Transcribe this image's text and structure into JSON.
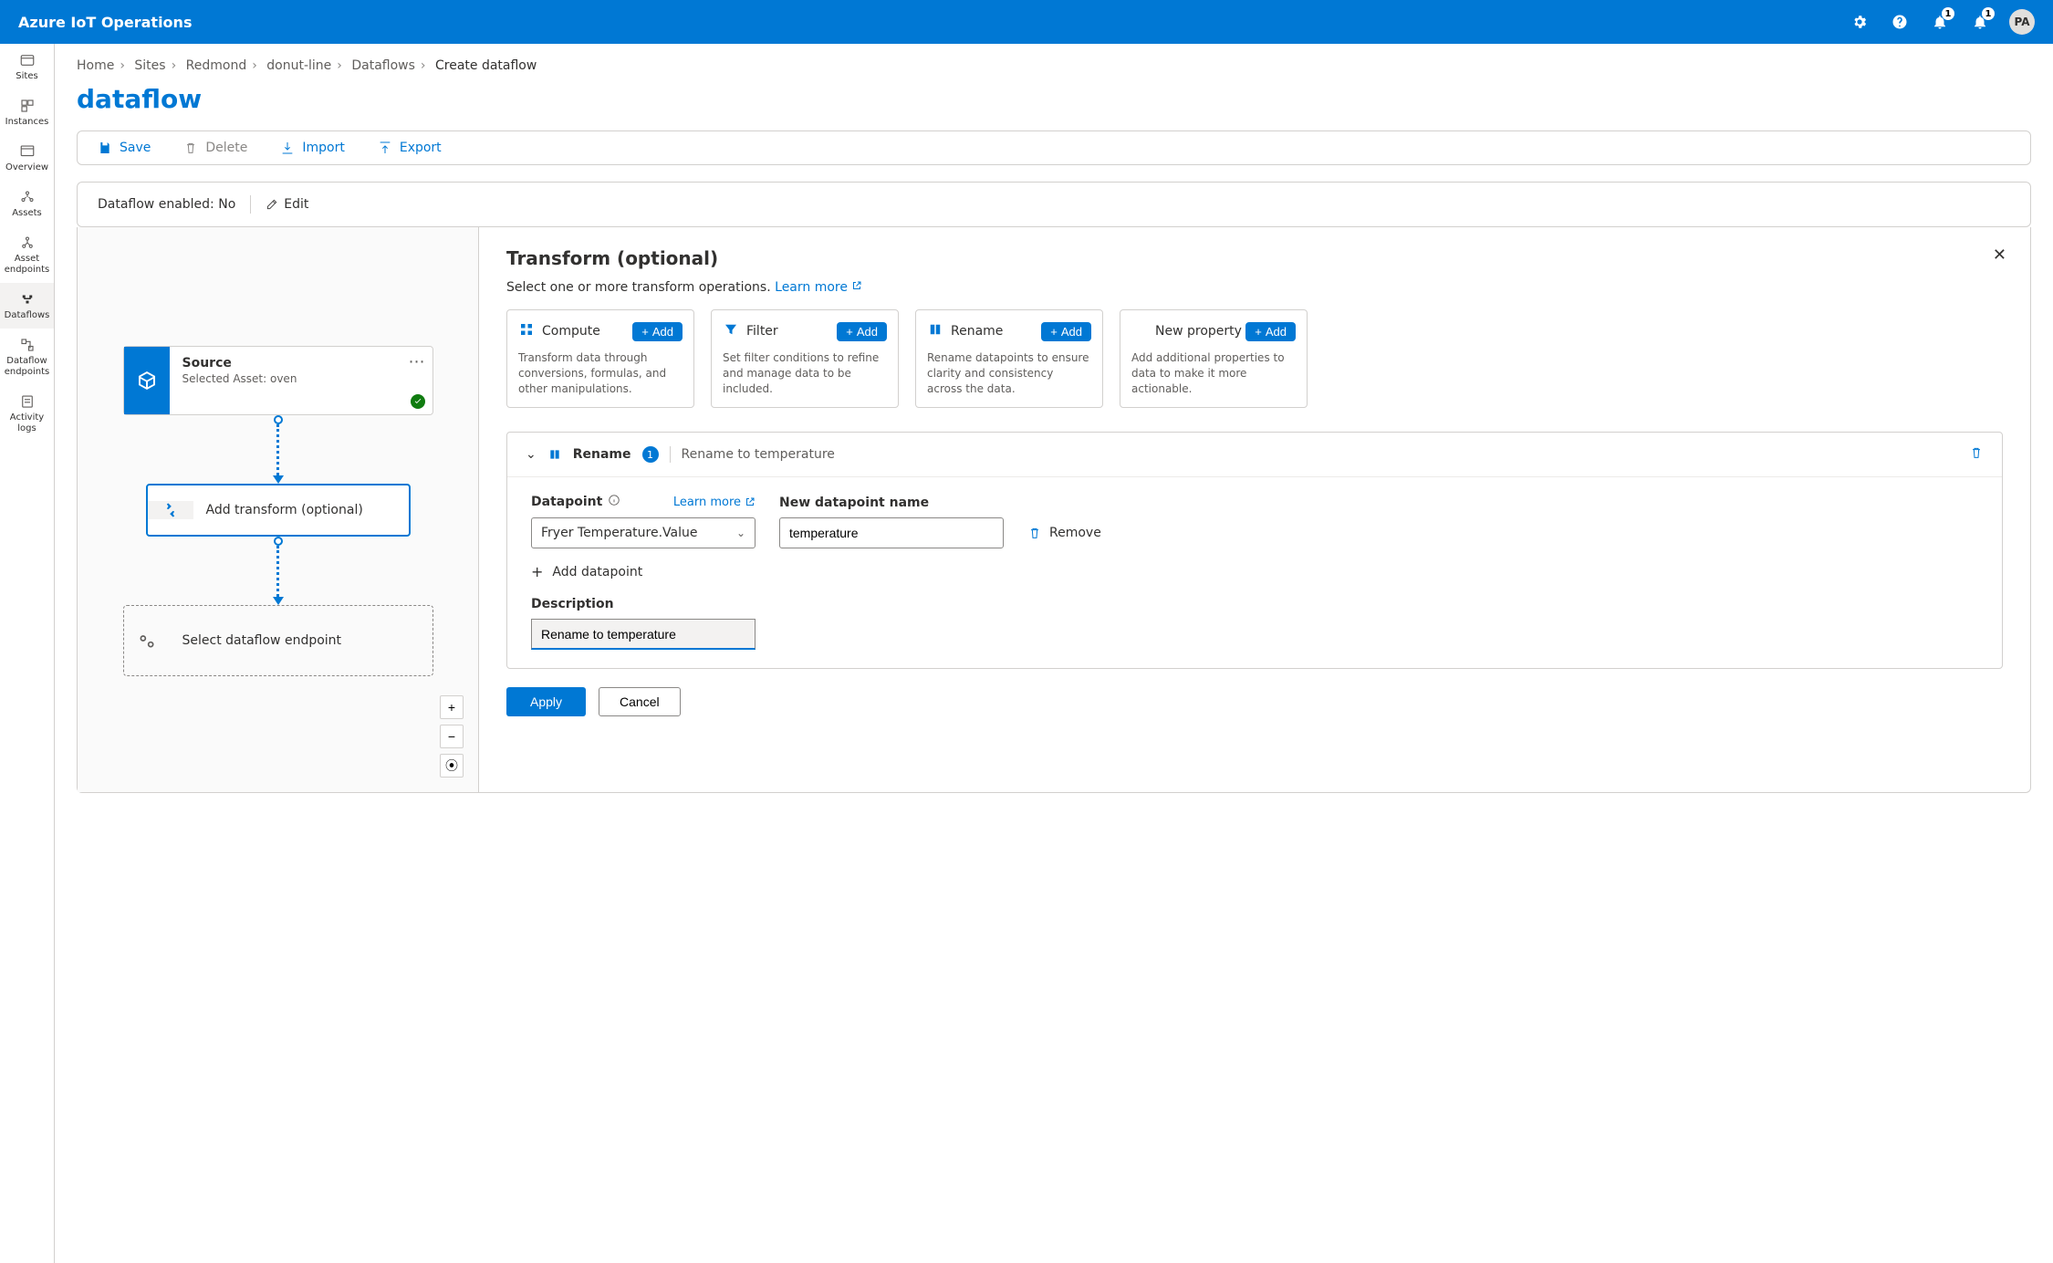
{
  "header": {
    "brand": "Azure IoT Operations",
    "badge1": "1",
    "badge2": "1",
    "avatar": "PA"
  },
  "sidebar": {
    "items": [
      {
        "label": "Sites"
      },
      {
        "label": "Instances"
      },
      {
        "label": "Overview"
      },
      {
        "label": "Assets"
      },
      {
        "label": "Asset endpoints"
      },
      {
        "label": "Dataflows"
      },
      {
        "label": "Dataflow endpoints"
      },
      {
        "label": "Activity logs"
      }
    ]
  },
  "breadcrumb": {
    "items": [
      "Home",
      "Sites",
      "Redmond",
      "donut-line",
      "Dataflows"
    ],
    "current": "Create dataflow"
  },
  "page": {
    "title": "dataflow"
  },
  "toolbar": {
    "save": "Save",
    "delete": "Delete",
    "import": "Import",
    "export": "Export"
  },
  "status": {
    "enabled_label": "Dataflow enabled:",
    "enabled_value": "No",
    "edit": "Edit"
  },
  "canvas": {
    "source": {
      "title": "Source",
      "subtitle": "Selected Asset: oven"
    },
    "transform": {
      "title": "Add transform (optional)"
    },
    "endpoint": {
      "title": "Select dataflow endpoint"
    }
  },
  "panel": {
    "title": "Transform (optional)",
    "subtitle": "Select one or more transform operations.",
    "learn_more": "Learn more",
    "ops": [
      {
        "name": "Compute",
        "desc": "Transform data through conversions, formulas, and other manipulations.",
        "add": "Add"
      },
      {
        "name": "Filter",
        "desc": "Set filter conditions to refine and manage data to be included.",
        "add": "Add"
      },
      {
        "name": "Rename",
        "desc": "Rename datapoints to ensure clarity and consistency across the data.",
        "add": "Add"
      },
      {
        "name": "New property",
        "desc": "Add additional properties to data to make it more actionable.",
        "add": "Add"
      }
    ],
    "section": {
      "name": "Rename",
      "count": "1",
      "summary": "Rename to temperature",
      "datapoint_label": "Datapoint",
      "learn_more": "Learn more",
      "datapoint_value": "Fryer Temperature.Value",
      "new_name_label": "New datapoint name",
      "new_name_value": "temperature",
      "remove": "Remove",
      "add_dp": "Add datapoint",
      "desc_label": "Description",
      "desc_value": "Rename to temperature"
    },
    "actions": {
      "apply": "Apply",
      "cancel": "Cancel"
    }
  }
}
